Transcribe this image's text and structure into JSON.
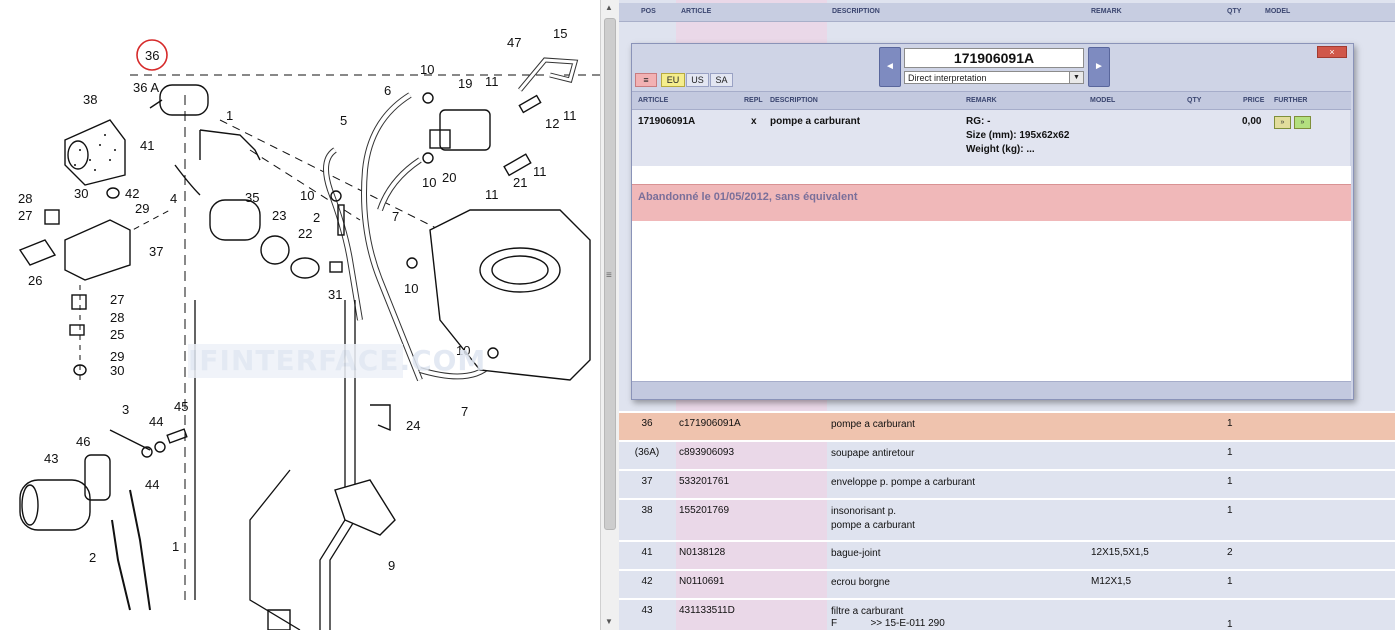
{
  "diagram": {
    "callouts": [
      "36",
      "36 A",
      "38",
      "1",
      "5",
      "6",
      "10",
      "19",
      "47",
      "15",
      "11",
      "12",
      "41",
      "4",
      "42",
      "29",
      "30",
      "28",
      "27",
      "35",
      "23",
      "22",
      "2",
      "31",
      "20",
      "21",
      "7",
      "37",
      "26",
      "25",
      "3",
      "44",
      "45",
      "46",
      "43",
      "24",
      "9"
    ],
    "watermark": "IFINTERFACE.COM"
  },
  "list": {
    "headers": {
      "pos": "POS",
      "article": "ARTICLE",
      "description": "DESCRIPTION",
      "remark": "REMARK",
      "qty": "QTY",
      "model": "MODEL"
    },
    "rows": [
      {
        "pos": "36",
        "article": "c171906091A",
        "description": "pompe a carburant",
        "remark": "",
        "qty": "1",
        "selected": true
      },
      {
        "pos": "(36A)",
        "article": "c893906093",
        "description": "soupape antiretour",
        "remark": "",
        "qty": "1"
      },
      {
        "pos": "37",
        "article": "533201761",
        "description": "enveloppe p. pompe a carburant",
        "remark": "",
        "qty": "1"
      },
      {
        "pos": "38",
        "article": "155201769",
        "description": "insonorisant p.",
        "description2": "pompe a carburant",
        "remark": "",
        "qty": "1"
      },
      {
        "pos": "41",
        "article": "N0138128",
        "description": "bague-joint",
        "remark": "12X15,5X1,5",
        "qty": "2"
      },
      {
        "pos": "42",
        "article": "N0110691",
        "description": "ecrou borgne",
        "remark": "M12X1,5",
        "qty": "1"
      },
      {
        "pos": "43",
        "article": "431133511D",
        "description": "filtre a carburant",
        "description2": "F            >> 15-E-011 290",
        "remark": "",
        "qty": "1"
      }
    ]
  },
  "popup": {
    "article_number": "171906091A",
    "interpretation": "Direct interpretation",
    "regions": [
      "≡",
      "EU",
      "US",
      "SA"
    ],
    "active_region": "EU",
    "close_label": "×",
    "prev_label": "◄",
    "next_label": "►",
    "headers": {
      "article": "ARTICLE",
      "repl": "REPL",
      "description": "DESCRIPTION",
      "remark": "REMARK",
      "model": "MODEL",
      "qty": "QTY",
      "price": "PRICE",
      "further": "FURTHER"
    },
    "row": {
      "article": "171906091A",
      "repl": "x",
      "description": "pompe a carburant",
      "remark_rg": "RG: -",
      "remark_size": "Size (mm): 195x62x62",
      "remark_weight": "Weight (kg): ...",
      "price": "0,00",
      "further_btn1": "»",
      "further_btn2": "»"
    },
    "note": "Abandonné le 01/05/2012, sans équivalent"
  },
  "colors": {
    "highlight_circle": "#d62a2a",
    "selected_row": "#efc3ae",
    "note_bg": "#f0b8b9",
    "nav_blue": "#7e8bc0"
  }
}
